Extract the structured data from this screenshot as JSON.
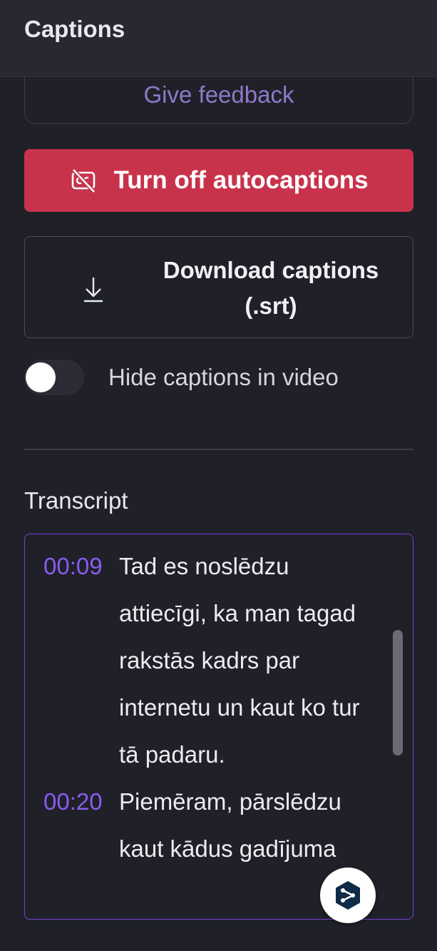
{
  "header": {
    "title": "Captions"
  },
  "feedback": {
    "label": "Give feedback"
  },
  "autocaptions_button": {
    "label": "Turn off autocaptions",
    "icon": "captions-off-icon",
    "color": "#c8324b"
  },
  "download_button": {
    "label_line1": "Download captions",
    "label_line2": "(.srt)",
    "icon": "download-icon"
  },
  "hide_captions_toggle": {
    "label": "Hide captions in video",
    "on": false
  },
  "transcript": {
    "title": "Transcript",
    "accent_color": "#8a5cf0",
    "entries": [
      {
        "time": "00:09",
        "text": "Tad es noslēdzu attiecīgi, ka man tagad rakstās kadrs par internetu un kaut ko tur tā padaru."
      },
      {
        "time": "00:20",
        "text": "Piemēram, pārslēdzu kaut kādus gadījuma"
      }
    ]
  },
  "floating_button": {
    "icon": "translate-assistant-icon"
  }
}
